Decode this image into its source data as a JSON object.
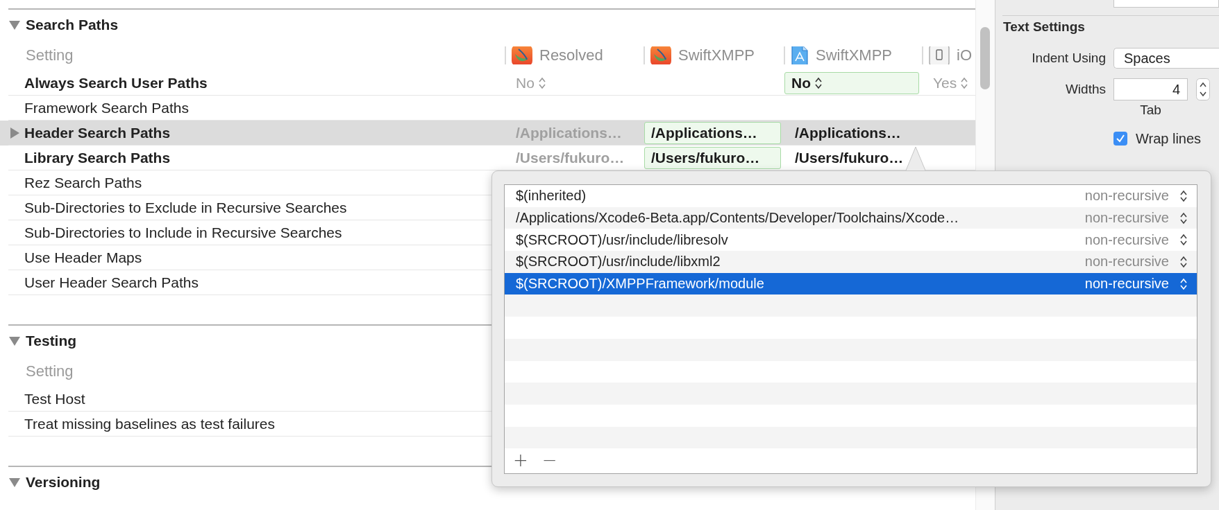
{
  "editor": {
    "sections": [
      {
        "title": "Search Paths",
        "expanded": true,
        "setting_label": "Setting",
        "columns": [
          {
            "label": "Resolved",
            "kind": "swift"
          },
          {
            "label": "SwiftXMPP",
            "kind": "swift"
          },
          {
            "label": "SwiftXMPP",
            "kind": "document"
          },
          {
            "label": "iO",
            "kind": "device"
          }
        ],
        "rows": [
          {
            "name": "Always Search User Paths",
            "bold": true,
            "selected": false,
            "cells": [
              {
                "kind": "popup",
                "text": "No",
                "inherited": true,
                "bold": false,
                "highlighted": false
              },
              {
                "kind": "empty"
              },
              {
                "kind": "popup",
                "text": "No",
                "inherited": false,
                "bold": true,
                "highlighted": true
              },
              {
                "kind": "popup",
                "text": "Yes",
                "inherited": true,
                "bold": false,
                "highlighted": false
              }
            ]
          },
          {
            "name": "Framework Search Paths",
            "bold": false,
            "selected": false
          },
          {
            "name": "Header Search Paths",
            "bold": true,
            "selected": true,
            "expanded": false,
            "cells": [
              {
                "kind": "text",
                "text": "/Applications…",
                "inherited": true,
                "bold": true,
                "highlighted": false
              },
              {
                "kind": "text",
                "text": "/Applications…",
                "inherited": false,
                "bold": true,
                "highlighted": true
              },
              {
                "kind": "text",
                "text": "/Applications…",
                "inherited": false,
                "bold": true,
                "highlighted": false
              }
            ]
          },
          {
            "name": "Library Search Paths",
            "bold": true,
            "selected": false,
            "cells": [
              {
                "kind": "text",
                "text": "/Users/fukuro…",
                "inherited": true,
                "bold": true,
                "highlighted": false
              },
              {
                "kind": "text",
                "text": "/Users/fukuro…",
                "inherited": false,
                "bold": true,
                "highlighted": true
              },
              {
                "kind": "text",
                "text": "/Users/fukuro…",
                "inherited": false,
                "bold": true,
                "highlighted": false
              }
            ]
          },
          {
            "name": "Rez Search Paths",
            "bold": false,
            "selected": false
          },
          {
            "name": "Sub-Directories to Exclude in Recursive Searches",
            "bold": false,
            "selected": false
          },
          {
            "name": "Sub-Directories to Include in Recursive Searches",
            "bold": false,
            "selected": false
          },
          {
            "name": "Use Header Maps",
            "bold": false,
            "selected": false
          },
          {
            "name": "User Header Search Paths",
            "bold": false,
            "selected": false
          }
        ]
      },
      {
        "title": "Testing",
        "expanded": true,
        "setting_label": "Setting",
        "rows": [
          {
            "name": "Test Host",
            "bold": false,
            "selected": false
          },
          {
            "name": "Treat missing baselines as test failures",
            "bold": false,
            "selected": false
          }
        ]
      },
      {
        "title": "Versioning",
        "expanded": true
      }
    ]
  },
  "popover": {
    "items": [
      {
        "path": "$(inherited)",
        "mode": "non-recursive",
        "selected": false
      },
      {
        "path": "/Applications/Xcode6-Beta.app/Contents/Developer/Toolchains/Xcode…",
        "mode": "non-recursive",
        "selected": false
      },
      {
        "path": "$(SRCROOT)/usr/include/libresolv",
        "mode": "non-recursive",
        "selected": false
      },
      {
        "path": "$(SRCROOT)/usr/include/libxml2",
        "mode": "non-recursive",
        "selected": false
      },
      {
        "path": "$(SRCROOT)/XMPPFramework/module",
        "mode": "non-recursive",
        "selected": true
      }
    ],
    "add_button": "+",
    "remove_button": "−"
  },
  "inspector": {
    "text_settings": {
      "title": "Text Settings",
      "indent_using": {
        "label": "Indent Using",
        "value": "Spaces"
      },
      "widths": {
        "label": "Widths",
        "value": "4",
        "caption": "Tab"
      },
      "wrap_lines": {
        "label": "Wrap lines",
        "checked": true
      }
    }
  }
}
